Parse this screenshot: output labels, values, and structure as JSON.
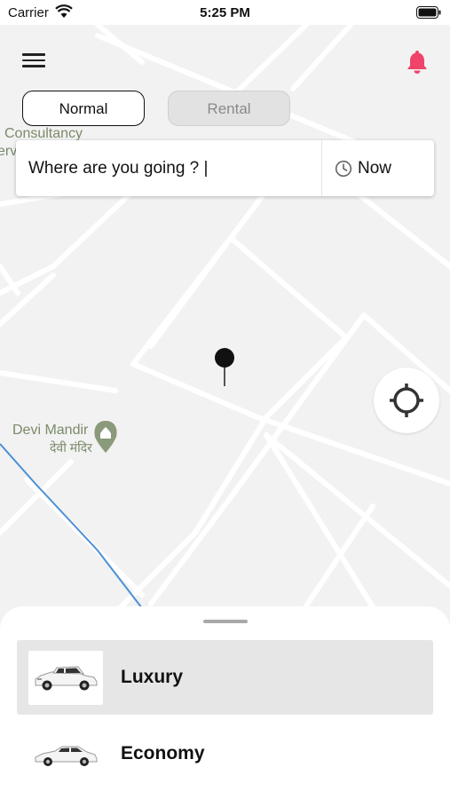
{
  "status_bar": {
    "carrier": "Carrier",
    "time": "5:25 PM"
  },
  "header": {
    "menu_icon": "hamburger-menu-icon",
    "notification_icon": "bell-icon",
    "bell_color": "#f0436a"
  },
  "mode_tabs": [
    {
      "label": "Normal",
      "state": "selected"
    },
    {
      "label": "Rental",
      "state": "disabled"
    }
  ],
  "map": {
    "poi_labels": [
      {
        "text": "l Consultancy"
      },
      {
        "text": "erv"
      },
      {
        "text": "Devi Mandir"
      },
      {
        "text": "देवी मंदिर"
      }
    ],
    "pin_icon": "map-pin-icon",
    "locate_icon": "crosshair-icon"
  },
  "search": {
    "value": "Where are you going ? |",
    "time_icon": "clock-icon",
    "time_label": "Now"
  },
  "vehicles": [
    {
      "name": "Luxury",
      "icon": "suv-car-icon",
      "selected": true
    },
    {
      "name": "Economy",
      "icon": "sedan-car-icon",
      "selected": false
    }
  ]
}
